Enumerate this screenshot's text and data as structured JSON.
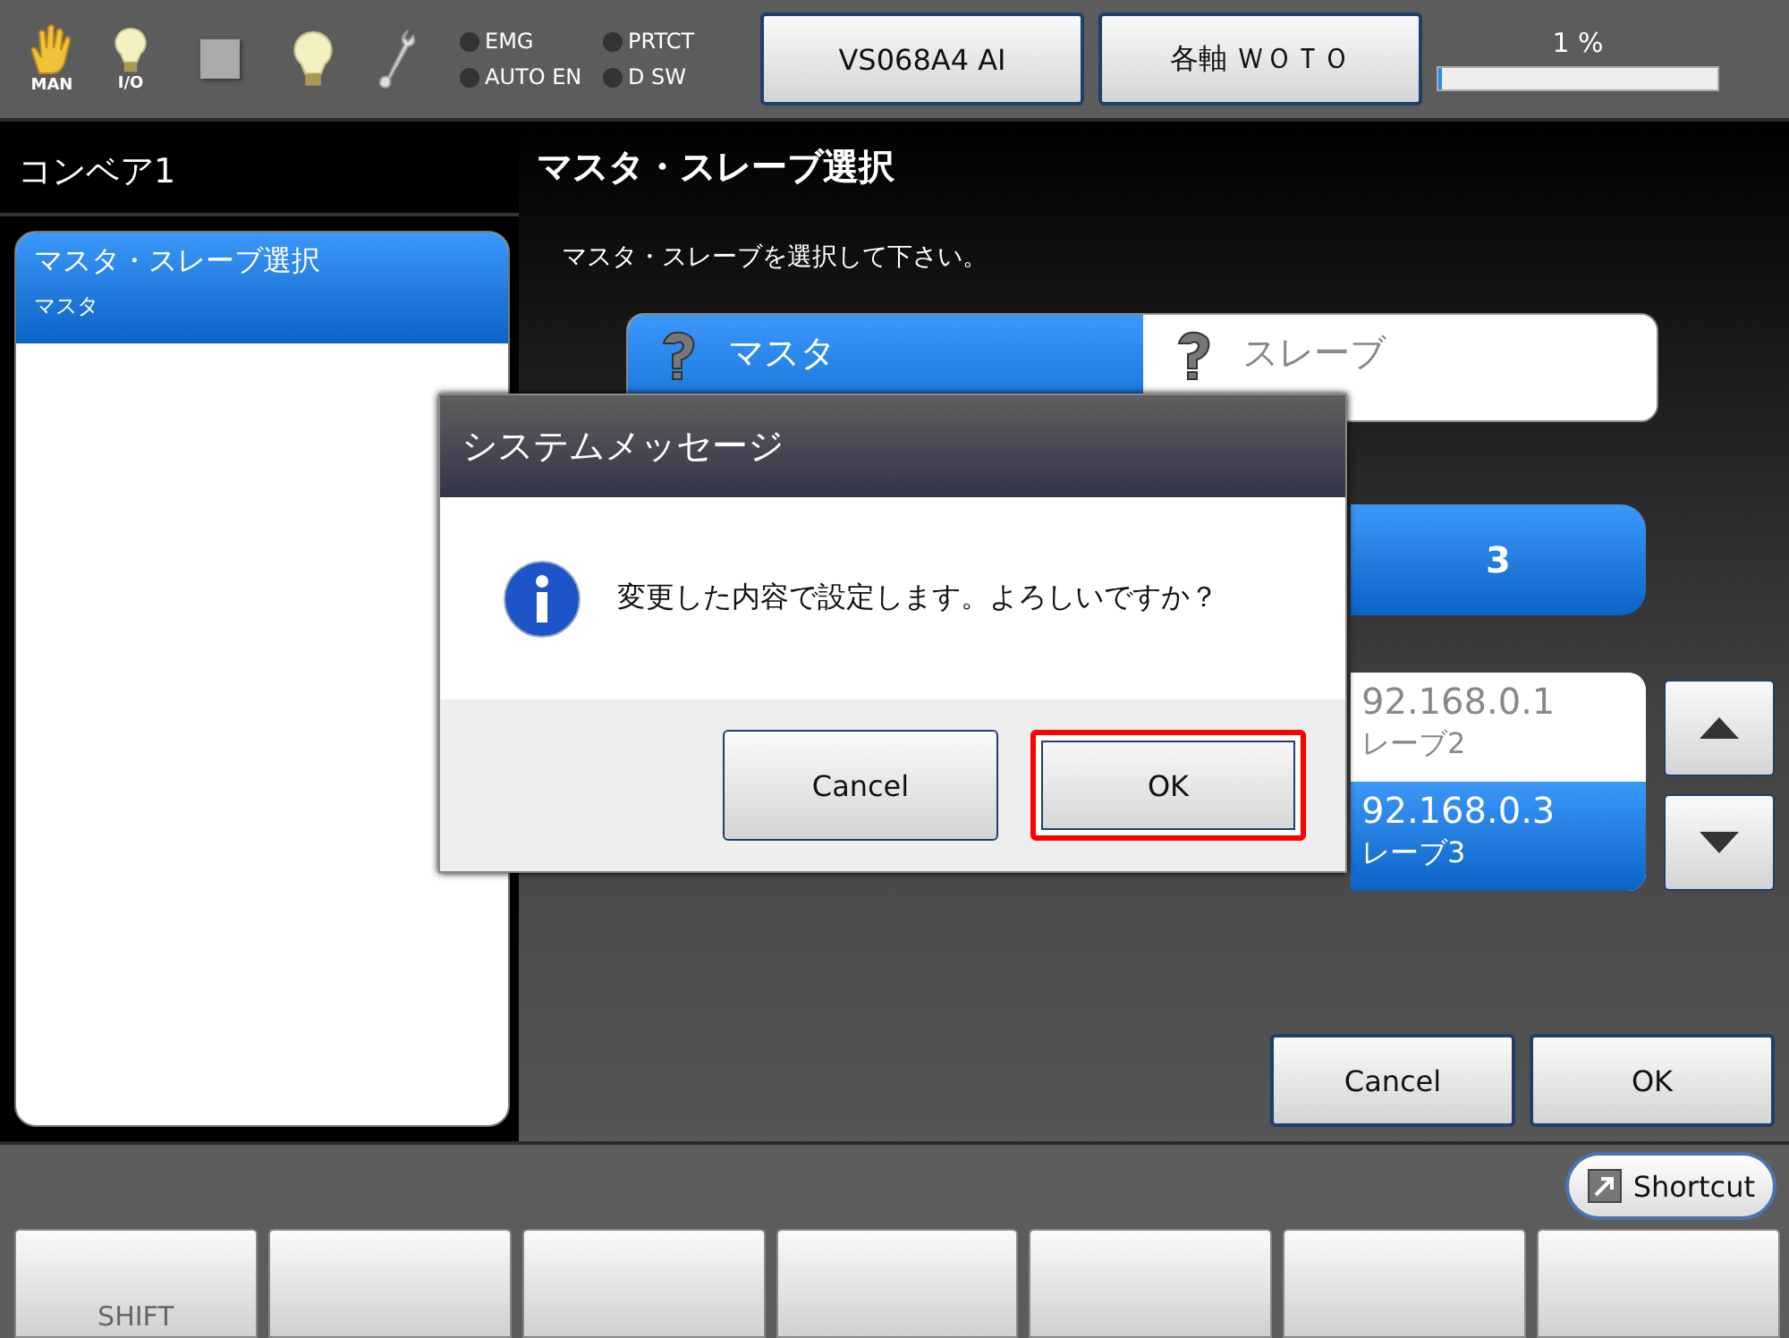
{
  "toolbar": {
    "mode_label": "MAN",
    "io_label": "I/O",
    "indicators": [
      {
        "label": "EMG",
        "on": false
      },
      {
        "label": "AUTO EN",
        "on": false
      },
      {
        "label": "PRTCT",
        "on": false
      },
      {
        "label": "D SW",
        "on": false
      }
    ],
    "buttons": [
      "VS068A4 AI",
      "各軸 ＷＯＴＯ"
    ],
    "progress": {
      "reading": "1 %",
      "level": 0.01
    }
  },
  "left_panel": {
    "title": "コンベア1",
    "items": [
      {
        "title": "マスタ・スレーブ選択",
        "value": "マスタ",
        "selected": true
      }
    ]
  },
  "main": {
    "title": "マスタ・スレーブ選択",
    "instruction": "マスタ・スレーブを選択して下さい。",
    "segments": [
      {
        "label": "マスタ",
        "selected": true
      },
      {
        "label": "スレーブ",
        "selected": false
      }
    ],
    "number_button": "3",
    "list": [
      {
        "address": "92.168.0.1",
        "name": "レーブ2",
        "selected": false
      },
      {
        "address": "92.168.0.3",
        "name": "レーブ3",
        "selected": true
      }
    ],
    "buttons": [
      "Cancel",
      "OK"
    ]
  },
  "dialog": {
    "title": "システムメッセージ",
    "message": "変更した内容で設定します。よろしいですか？",
    "buttons": [
      {
        "label": "Cancel",
        "focused": false
      },
      {
        "label": "OK",
        "focused": true
      }
    ]
  },
  "footer": {
    "shortcut": "Shortcut",
    "function_keys": [
      "SHIFT"
    ]
  }
}
